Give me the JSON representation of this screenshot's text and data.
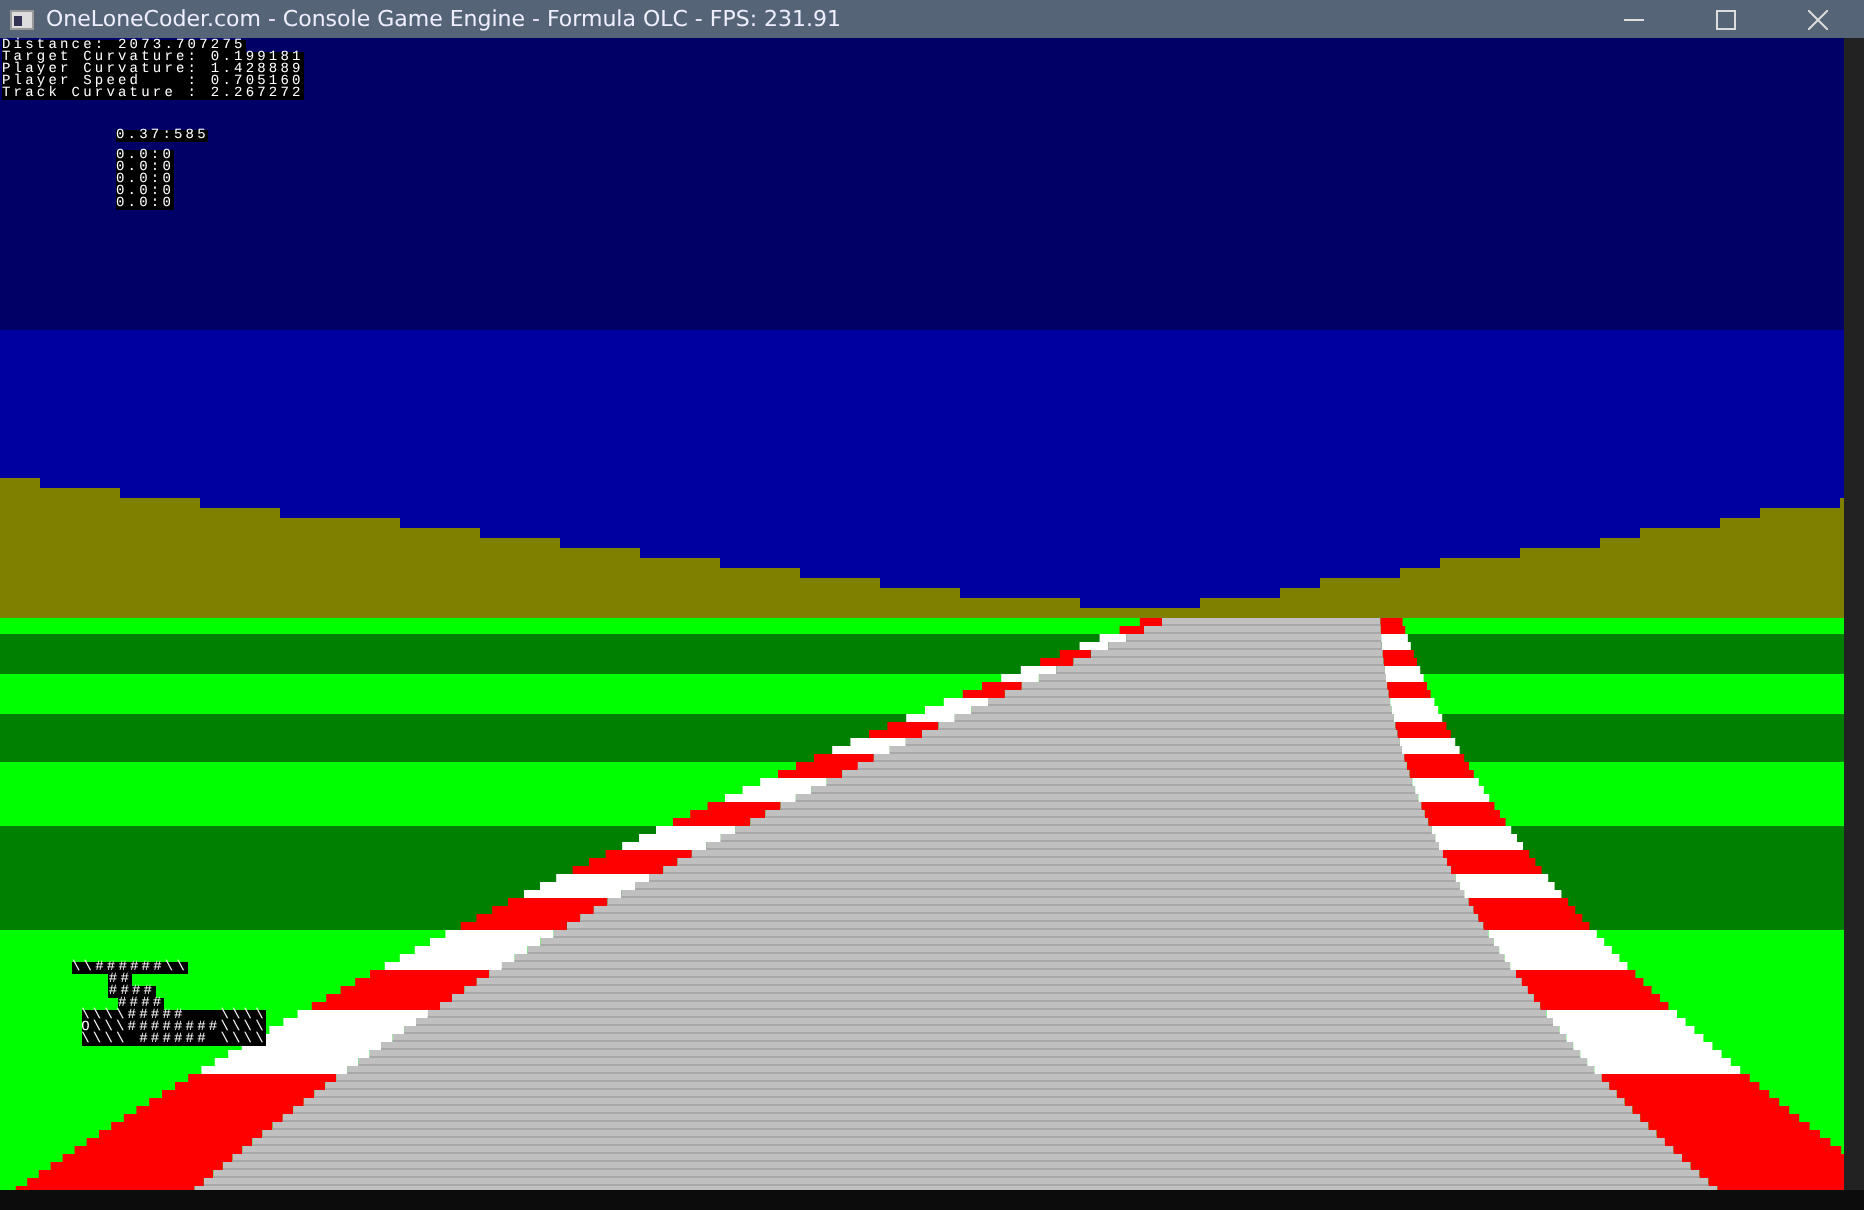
{
  "window": {
    "title": "OneLoneCoder.com - Console Game Engine - Formula OLC - FPS: 231.91"
  },
  "hud": {
    "stats": [
      "Distance: 2073.707275",
      "Target Curvature: 0.199181",
      "Player Curvature: 1.428889",
      "Player Speed    : 0.705160",
      "Track Curvature : 2.267272"
    ],
    "current_lap": "0.37:585",
    "lap_times": [
      "0.0:0",
      "0.0:0",
      "0.0:0",
      "0.0:0",
      "0.0:0"
    ]
  },
  "car": {
    "lines": [
      "\\\\######\\\\",
      "##",
      "####",
      "####",
      "\\\\\\\\#####   \\\\\\\\",
      "O\\\\\\########\\\\\\\\",
      "\\\\\\\\ ###### \\\\\\\\"
    ]
  }
}
